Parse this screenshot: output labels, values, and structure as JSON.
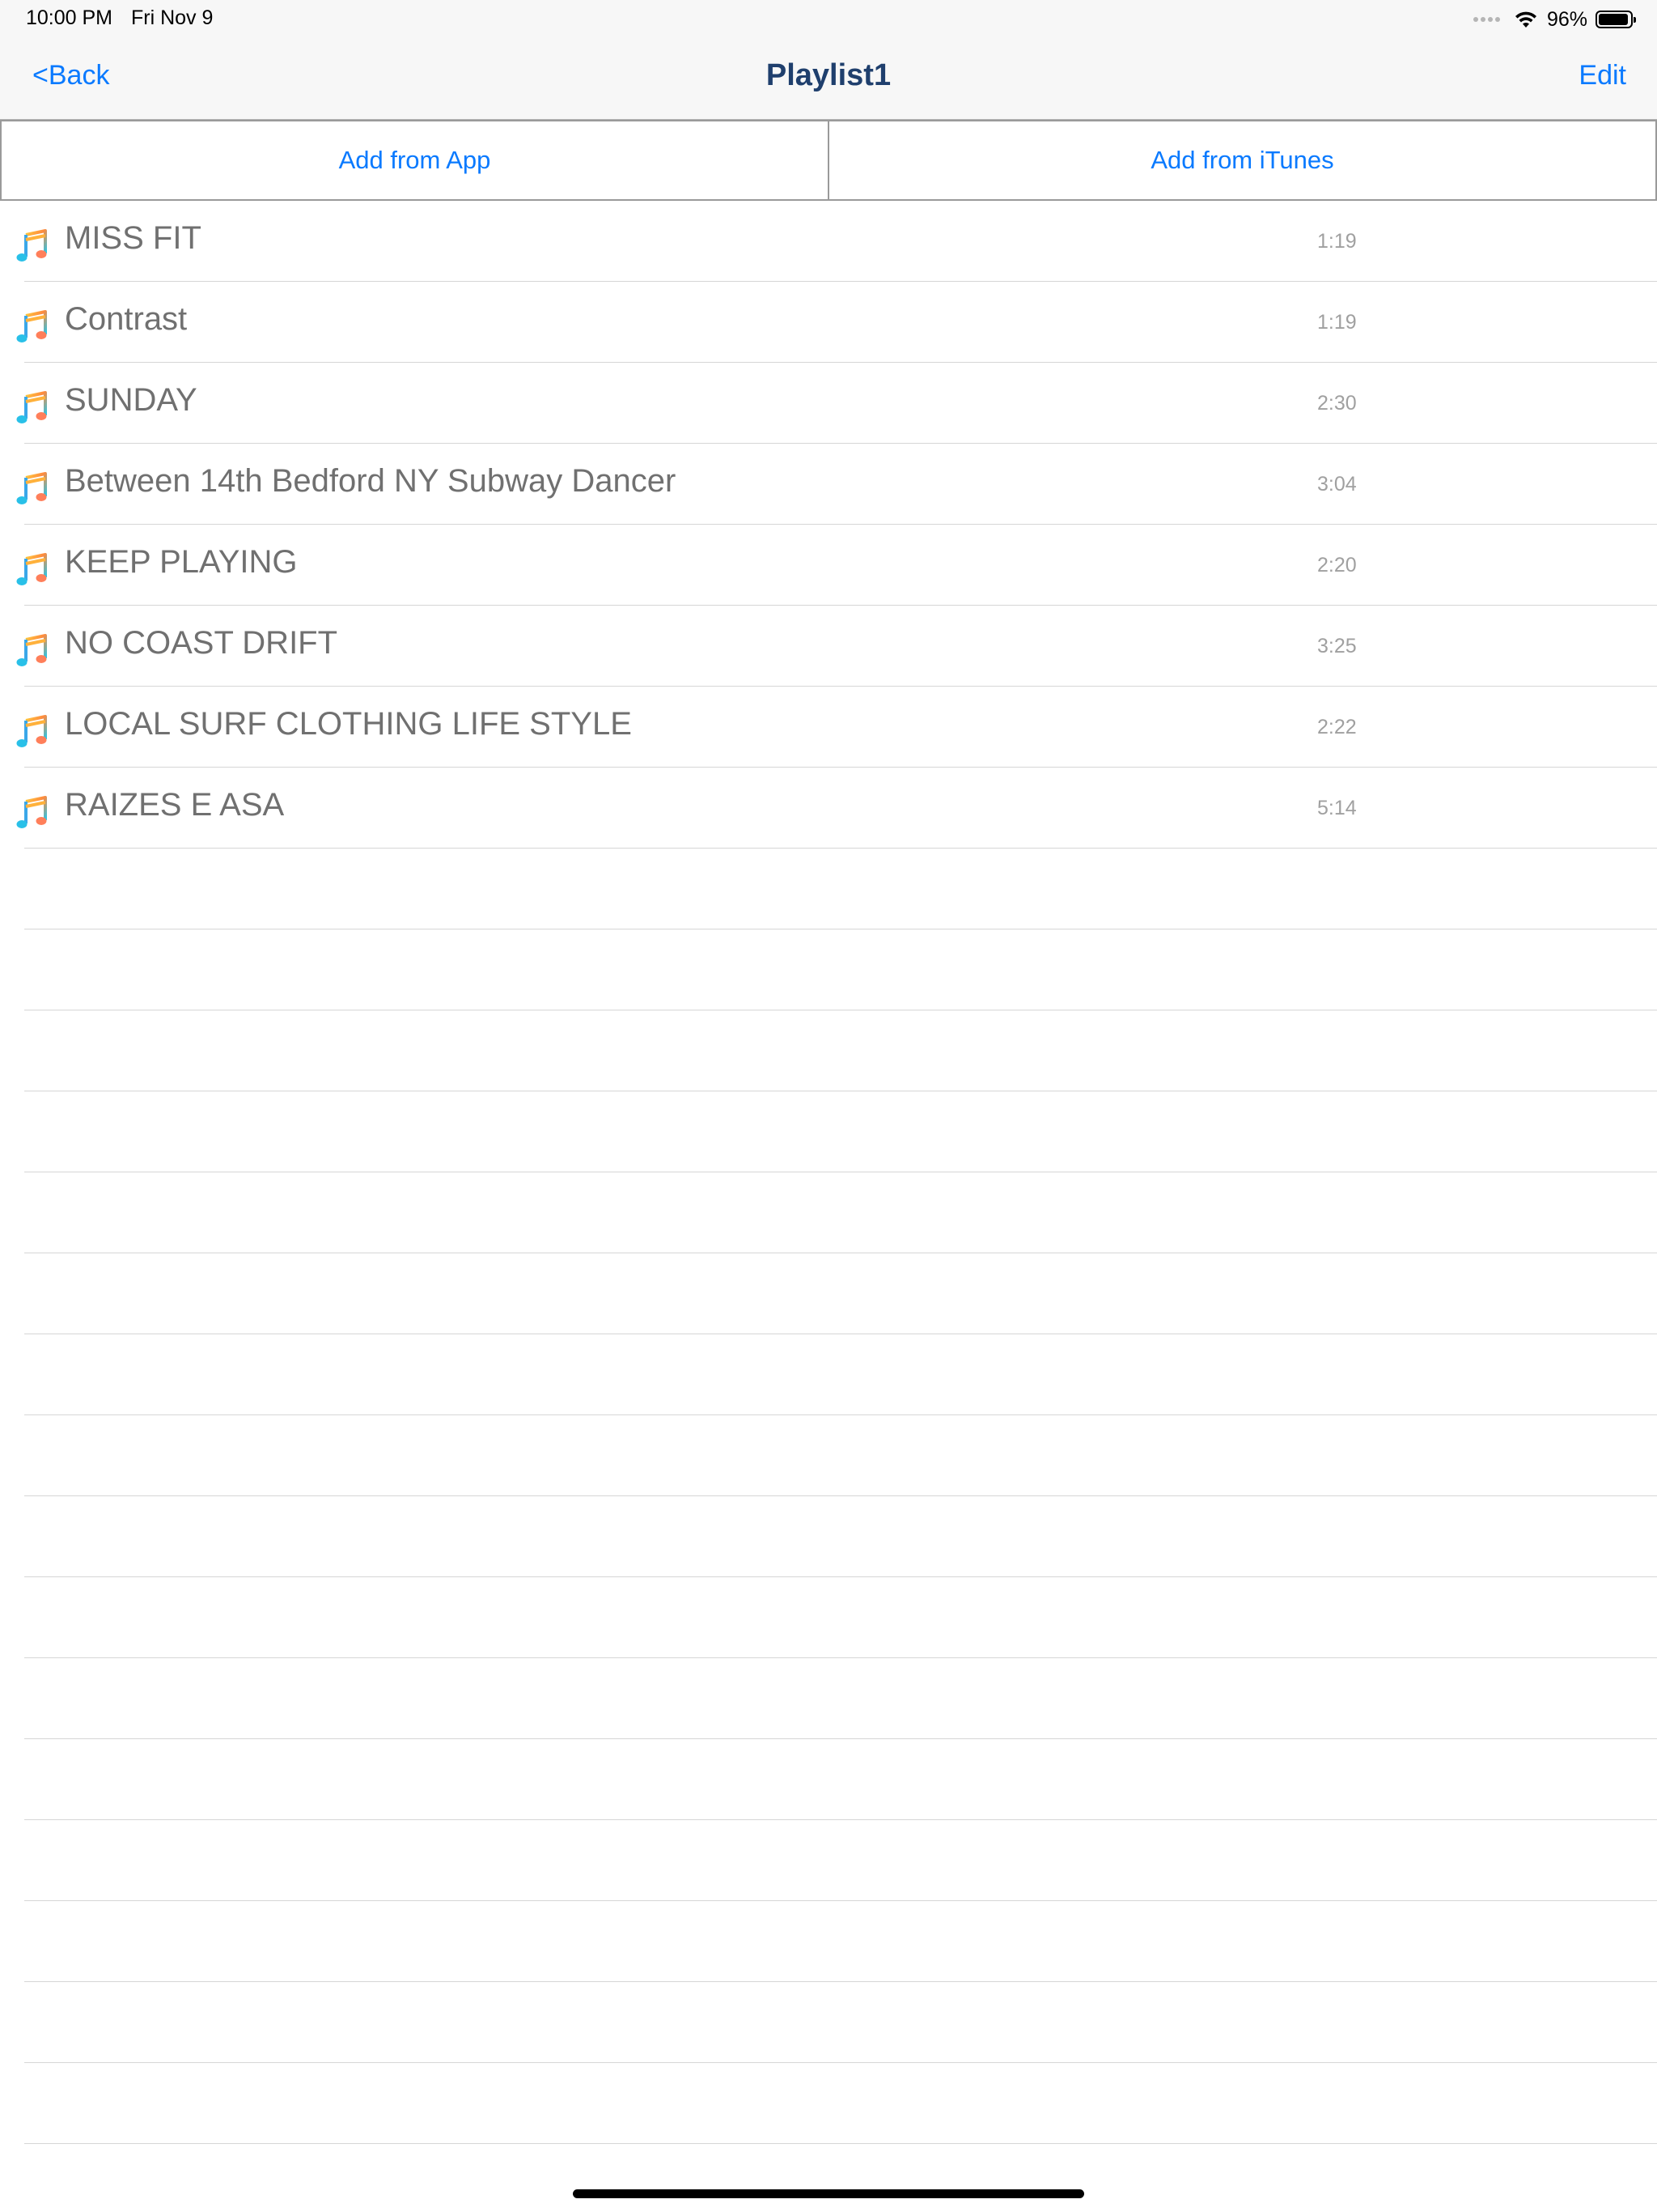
{
  "status_bar": {
    "time": "10:00 PM",
    "date": "Fri Nov 9",
    "battery_pct": "96%",
    "battery_level": 0.96
  },
  "nav": {
    "back_label": "<Back",
    "title": "Playlist1",
    "edit_label": "Edit"
  },
  "actions": {
    "add_from_app": "Add from App",
    "add_from_itunes": "Add from iTunes"
  },
  "tracks": [
    {
      "title": "MISS FIT",
      "duration": "1:19"
    },
    {
      "title": "Contrast",
      "duration": "1:19"
    },
    {
      "title": "SUNDAY",
      "duration": "2:30"
    },
    {
      "title": "Between 14th Bedford NY Subway Dancer",
      "duration": "3:04"
    },
    {
      "title": "KEEP PLAYING",
      "duration": "2:20"
    },
    {
      "title": "NO COAST DRIFT",
      "duration": "3:25"
    },
    {
      "title": "LOCAL SURF CLOTHING LIFE STYLE",
      "duration": "2:22"
    },
    {
      "title": "RAIZES E ASA",
      "duration": "5:14"
    }
  ],
  "icons": {
    "track": "music-note-icon",
    "wifi": "wifi-icon",
    "battery": "battery-icon",
    "signal": "signal-icon"
  },
  "colors": {
    "accent": "#0a7aff",
    "title": "#1f3f6d",
    "track_text": "#707070",
    "duration_text": "#a0a0a0"
  }
}
